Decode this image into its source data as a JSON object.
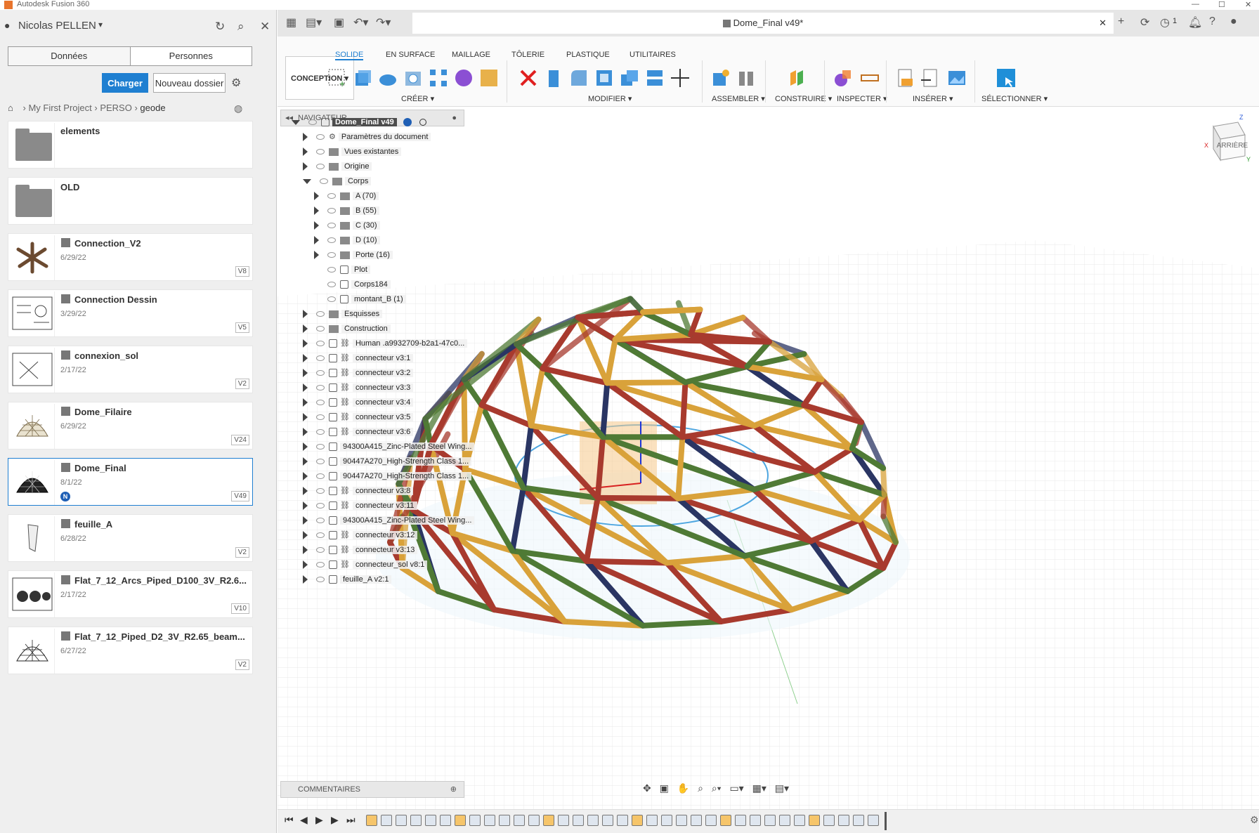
{
  "app": {
    "title": "Autodesk Fusion 360"
  },
  "user": {
    "name": "Nicolas PELLEN"
  },
  "panel": {
    "tabs": [
      "Données",
      "Personnes"
    ],
    "upload_label": "Charger",
    "new_folder_label": "Nouveau dossier",
    "breadcrumb": [
      "My First Project",
      "PERSO",
      "geode"
    ]
  },
  "files": [
    {
      "name": "elements",
      "type": "folder"
    },
    {
      "name": "OLD",
      "type": "folder"
    },
    {
      "name": "Connection_V2",
      "date": "6/29/22",
      "version": "V8"
    },
    {
      "name": "Connection Dessin",
      "date": "3/29/22",
      "version": "V5"
    },
    {
      "name": "connexion_sol",
      "date": "2/17/22",
      "version": "V2"
    },
    {
      "name": "Dome_Filaire",
      "date": "6/29/22",
      "version": "V24"
    },
    {
      "name": "Dome_Final",
      "date": "8/1/22",
      "version": "V49",
      "selected": true,
      "badge": "N"
    },
    {
      "name": "feuille_A",
      "date": "6/28/22",
      "version": "V2"
    },
    {
      "name": "Flat_7_12_Arcs_Piped_D100_3V_R2.6...",
      "date": "2/17/22",
      "version": "V10"
    },
    {
      "name": "Flat_7_12_Piped_D2_3V_R2.65_beam...",
      "date": "6/27/22",
      "version": "V2"
    }
  ],
  "document": {
    "tab_title": "Dome_Final v49*",
    "jobs_count": "1"
  },
  "toolbar": {
    "workspace": "CONCEPTION",
    "tabs": [
      "SOLIDE",
      "EN SURFACE",
      "MAILLAGE",
      "TÔLERIE",
      "PLASTIQUE",
      "UTILITAIRES"
    ],
    "groups": [
      "CRÉER",
      "MODIFIER",
      "ASSEMBLER",
      "CONSTRUIRE",
      "INSPECTER",
      "INSÉRER",
      "SÉLECTIONNER"
    ]
  },
  "navigator": {
    "title": "NAVIGATEUR",
    "root": "Dome_Final v49",
    "items": [
      "Paramètres du document",
      "Vues existantes",
      "Origine",
      "Corps",
      "A (70)",
      "B (55)",
      "C (30)",
      "D (10)",
      "Porte (16)",
      "Plot",
      "Corps184",
      "montant_B (1)",
      "Esquisses",
      "Construction",
      "Human .a9932709-b2a1-47c0...",
      "connecteur v3:1",
      "connecteur v3:2",
      "connecteur v3:3",
      "connecteur v3:4",
      "connecteur v3:5",
      "connecteur v3:6",
      "94300A415_Zinc-Plated Steel Wing...",
      "90447A270_High-Strength Class 1...",
      "90447A270_High-Strength Class 1...",
      "connecteur v3:8",
      "connecteur v3:11",
      "94300A415_Zinc-Plated Steel Wing...",
      "connecteur v3:12",
      "connecteur v3:13",
      "connecteur_sol v8:1",
      "feuille_A v2:1"
    ]
  },
  "comments": {
    "title": "COMMENTAIRES"
  },
  "viewcube": {
    "face": "ARRIÈRE"
  },
  "colors": {
    "accent": "#1f7fd1",
    "red": "#a83a2e",
    "yellow": "#d9a23a",
    "green": "#4f7a35",
    "navy": "#2a3563"
  }
}
